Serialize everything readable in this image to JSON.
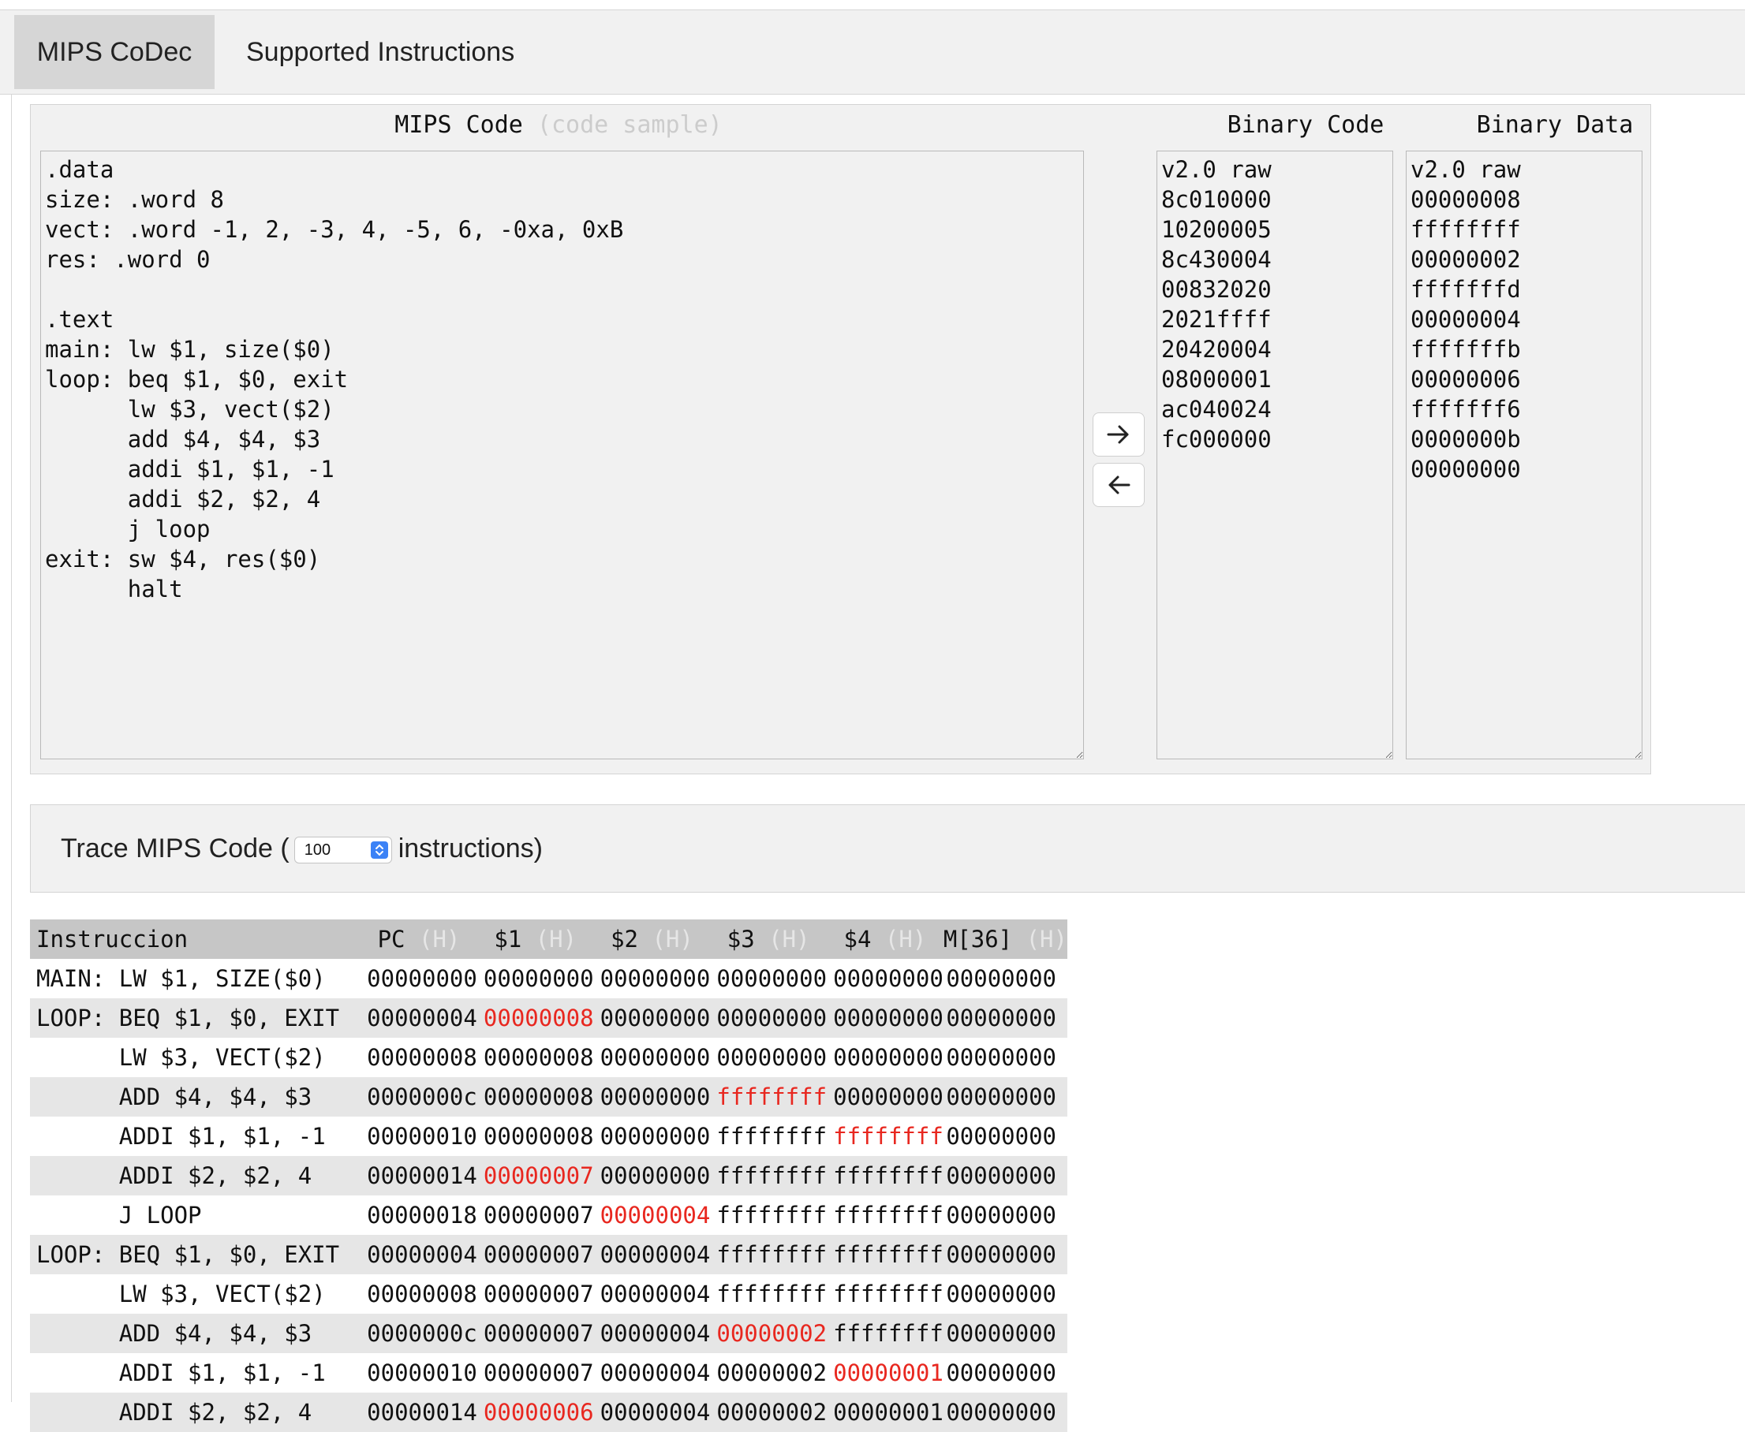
{
  "tabs": [
    {
      "label": "MIPS CoDec",
      "active": true
    },
    {
      "label": "Supported Instructions",
      "active": false
    }
  ],
  "editor": {
    "mips_title": "MIPS Code",
    "mips_sample_link": "(code sample)",
    "binary_code_title": "Binary Code",
    "binary_data_title": "Binary Data",
    "mips_code": ".data\nsize: .word 8\nvect: .word -1, 2, -3, 4, -5, 6, -0xa, 0xB\nres: .word 0\n\n.text\nmain: lw $1, size($0)\nloop: beq $1, $0, exit\n      lw $3, vect($2)\n      add $4, $4, $3\n      addi $1, $1, -1\n      addi $2, $2, 4\n      j loop\nexit: sw $4, res($0)\n      halt",
    "binary_code": "v2.0 raw\n8c010000\n10200005\n8c430004\n00832020\n2021ffff\n20420004\n08000001\nac040024\nfc000000",
    "binary_data": "v2.0 raw\n00000008\nffffffff\n00000002\nfffffffd\n00000004\nfffffffb\n00000006\nfffffff6\n0000000b\n00000000",
    "encode_icon": "arrow-right-icon",
    "decode_icon": "arrow-left-icon"
  },
  "trace": {
    "label_prefix": "Trace MIPS Code (",
    "instructions_count": "100",
    "label_suffix": "instructions)"
  },
  "table": {
    "headers": [
      "Instruccion",
      "PC",
      "$1",
      "$2",
      "$3",
      "$4",
      "M[36]"
    ],
    "hex_suffix": "(H)",
    "rows": [
      {
        "instr": "MAIN: LW $1, SIZE($0)",
        "vals": [
          "00000000",
          "00000000",
          "00000000",
          "00000000",
          "00000000",
          "00000000"
        ],
        "changed": []
      },
      {
        "instr": "LOOP: BEQ $1, $0, EXIT",
        "vals": [
          "00000004",
          "00000008",
          "00000000",
          "00000000",
          "00000000",
          "00000000"
        ],
        "changed": [
          1
        ]
      },
      {
        "instr": "      LW $3, VECT($2)",
        "vals": [
          "00000008",
          "00000008",
          "00000000",
          "00000000",
          "00000000",
          "00000000"
        ],
        "changed": []
      },
      {
        "instr": "      ADD $4, $4, $3",
        "vals": [
          "0000000c",
          "00000008",
          "00000000",
          "ffffffff",
          "00000000",
          "00000000"
        ],
        "changed": [
          3
        ]
      },
      {
        "instr": "      ADDI $1, $1, -1",
        "vals": [
          "00000010",
          "00000008",
          "00000000",
          "ffffffff",
          "ffffffff",
          "00000000"
        ],
        "changed": [
          4
        ]
      },
      {
        "instr": "      ADDI $2, $2, 4",
        "vals": [
          "00000014",
          "00000007",
          "00000000",
          "ffffffff",
          "ffffffff",
          "00000000"
        ],
        "changed": [
          1
        ]
      },
      {
        "instr": "      J LOOP",
        "vals": [
          "00000018",
          "00000007",
          "00000004",
          "ffffffff",
          "ffffffff",
          "00000000"
        ],
        "changed": [
          2
        ]
      },
      {
        "instr": "LOOP: BEQ $1, $0, EXIT",
        "vals": [
          "00000004",
          "00000007",
          "00000004",
          "ffffffff",
          "ffffffff",
          "00000000"
        ],
        "changed": []
      },
      {
        "instr": "      LW $3, VECT($2)",
        "vals": [
          "00000008",
          "00000007",
          "00000004",
          "ffffffff",
          "ffffffff",
          "00000000"
        ],
        "changed": []
      },
      {
        "instr": "      ADD $4, $4, $3",
        "vals": [
          "0000000c",
          "00000007",
          "00000004",
          "00000002",
          "ffffffff",
          "00000000"
        ],
        "changed": [
          3
        ]
      },
      {
        "instr": "      ADDI $1, $1, -1",
        "vals": [
          "00000010",
          "00000007",
          "00000004",
          "00000002",
          "00000001",
          "00000000"
        ],
        "changed": [
          4
        ]
      },
      {
        "instr": "      ADDI $2, $2, 4",
        "vals": [
          "00000014",
          "00000006",
          "00000004",
          "00000002",
          "00000001",
          "00000000"
        ],
        "changed": [
          1
        ]
      }
    ]
  },
  "colors": {
    "changed_value": "#e8271f",
    "panel_bg": "#f1f1f1",
    "header_bg": "#c6c6c6",
    "stripe": "#e6e6e6"
  }
}
